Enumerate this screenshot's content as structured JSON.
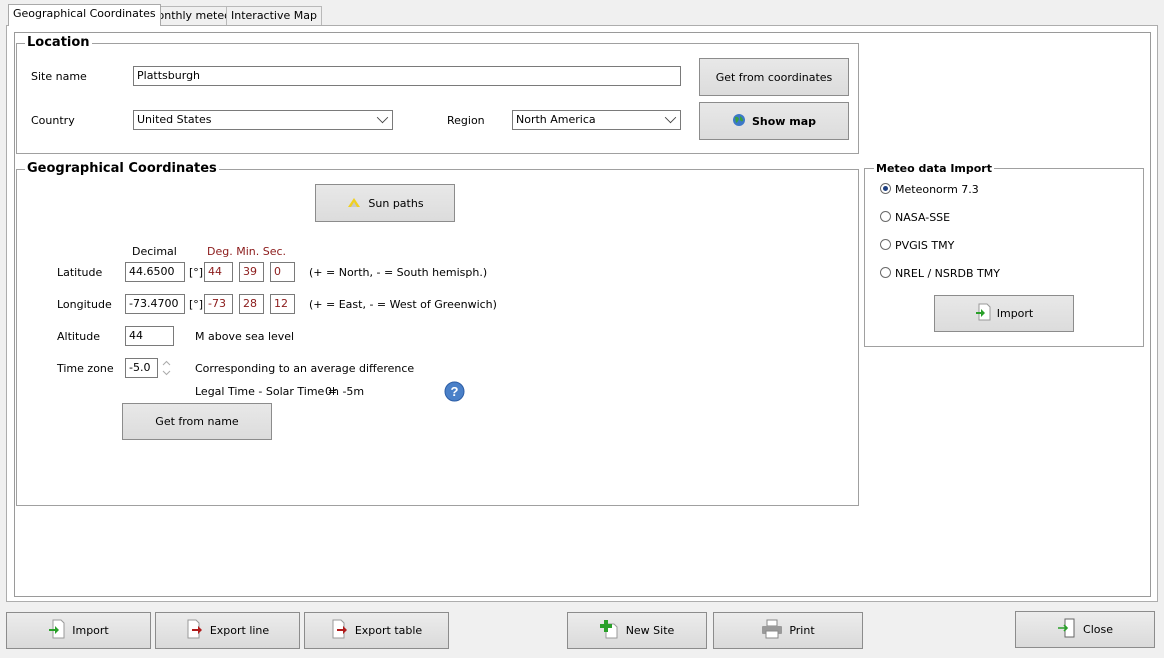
{
  "tabs": [
    {
      "label": "Geographical Coordinates",
      "active": true
    },
    {
      "label": "Monthly meteo",
      "active": false
    },
    {
      "label": "Interactive Map",
      "active": false
    }
  ],
  "location": {
    "title": "Location",
    "site_name_label": "Site name",
    "site_name_value": "Plattsburgh",
    "country_label": "Country",
    "country_value": "United States",
    "region_label": "Region",
    "region_value": "North America",
    "get_from_coordinates": "Get from coordinates",
    "show_map": "Show map"
  },
  "geo": {
    "title": "Geographical Coordinates",
    "sun_paths": "Sun paths",
    "decimal_header": "Decimal",
    "dms_header": "Deg. Min. Sec.",
    "latitude_label": "Latitude",
    "latitude_decimal": "44.6500",
    "latitude_unit": "[°]",
    "latitude_deg": "44",
    "latitude_min": "39",
    "latitude_sec": "0",
    "latitude_note": "(+ = North, - = South hemisph.)",
    "longitude_label": "Longitude",
    "longitude_decimal": "-73.4700",
    "longitude_unit": "[°]",
    "longitude_deg": "-73",
    "longitude_min": "28",
    "longitude_sec": "12",
    "longitude_note": "(+ = East, - = West of Greenwich)",
    "altitude_label": "Altitude",
    "altitude_value": "44",
    "altitude_note": "M above sea level",
    "timezone_label": "Time zone",
    "timezone_value": "-5.0",
    "timezone_note": "Corresponding to an average difference",
    "legal_solar_label": "Legal Time - Solar Time =",
    "legal_solar_value": "0h -5m",
    "get_from_name": "Get from name"
  },
  "meteo": {
    "title": "Meteo data Import",
    "options": [
      {
        "label": "Meteonorm 7.3",
        "checked": true
      },
      {
        "label": "NASA-SSE",
        "checked": false
      },
      {
        "label": "PVGIS TMY",
        "checked": false
      },
      {
        "label": "NREL / NSRDB TMY",
        "checked": false
      }
    ],
    "import": "Import"
  },
  "bottom": {
    "import": "Import",
    "export_line": "Export line",
    "export_table": "Export table",
    "new_site": "New Site",
    "print": "Print",
    "close": "Close"
  },
  "colors": {
    "dms_red": "#8b1a1a",
    "help_blue": "#4a80c8",
    "arrow_green": "#2aa02a",
    "arrow_red": "#b01c1c"
  }
}
